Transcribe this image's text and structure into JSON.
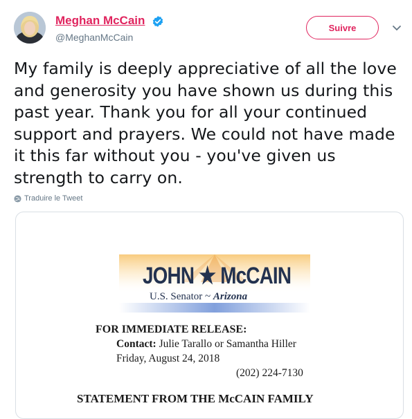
{
  "header": {
    "display_name": "Meghan McCain",
    "handle": "@MeghanMcCain",
    "follow_label": "Suivre",
    "name_color": "#e0245e",
    "verified_icon": "verified-badge-icon"
  },
  "tweet": {
    "text": "My family is deeply appreciative of all the love and generosity you have shown us during this past year. Thank you for all your continued support and prayers. We could not have made it this far without you - you've given us strength to carry on.",
    "translate_label": "Traduire le Tweet"
  },
  "press_release": {
    "logo_name": "JOHN ★ McCAIN",
    "logo_subtitle_prefix": "U.S. Senator ~ ",
    "logo_subtitle_state": "Arizona",
    "release_heading": "FOR IMMEDIATE RELEASE:",
    "contact_label": "Contact:",
    "contact_names": " Julie Tarallo or Samantha Hiller",
    "date": "Friday, August 24, 2018",
    "phone": "(202) 224-7130",
    "statement_title": "STATEMENT FROM THE McCAIN FAMILY"
  }
}
